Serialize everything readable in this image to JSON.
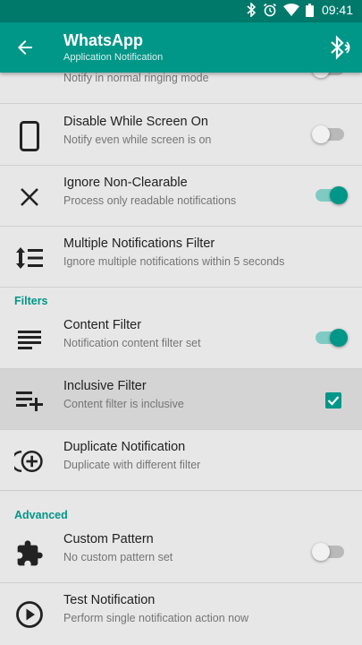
{
  "status_bar": {
    "time": "09:41",
    "icons": [
      "bluetooth-icon",
      "alarm-icon",
      "wifi-icon",
      "battery-icon"
    ]
  },
  "app_bar": {
    "title": "WhatsApp",
    "subtitle": "Application Notification",
    "back_icon": "arrow-left-icon",
    "action_icon": "bluetooth-searching-icon"
  },
  "partial_row": {
    "subtitle": "Notify in normal ringing mode"
  },
  "rows": [
    {
      "title": "Disable While Screen On",
      "subtitle": "Notify even while screen is on",
      "icon": "phone-icon",
      "control": "toggle",
      "state": "off"
    },
    {
      "title": "Ignore Non-Clearable",
      "subtitle": "Process only readable notifications",
      "icon": "close-icon",
      "control": "toggle",
      "state": "on"
    },
    {
      "title": "Multiple Notifications Filter",
      "subtitle": "Ignore multiple notifications within 5 seconds",
      "icon": "line-spacing-icon",
      "control": "none"
    }
  ],
  "sections": {
    "filters": "Filters",
    "advanced": "Advanced"
  },
  "filter_rows": [
    {
      "title": "Content Filter",
      "subtitle": "Notification content filter set",
      "icon": "text-lines-icon",
      "control": "toggle",
      "state": "on"
    },
    {
      "title": "Inclusive Filter",
      "subtitle": "Content filter is inclusive",
      "icon": "playlist-add-icon",
      "control": "checkbox",
      "state": "checked"
    },
    {
      "title": "Duplicate Notification",
      "subtitle": "Duplicate with different filter",
      "icon": "add-circle-duplicate-icon",
      "control": "none"
    }
  ],
  "advanced_rows": [
    {
      "title": "Custom Pattern",
      "subtitle": "No custom pattern set",
      "icon": "puzzle-icon",
      "control": "toggle",
      "state": "off"
    },
    {
      "title": "Test Notification",
      "subtitle": "Perform single notification action now",
      "icon": "play-circle-icon",
      "control": "none"
    }
  ],
  "colors": {
    "status_bar": "#00796b",
    "app_bar": "#009688",
    "accent": "#009688",
    "background": "#e7e7e7"
  }
}
